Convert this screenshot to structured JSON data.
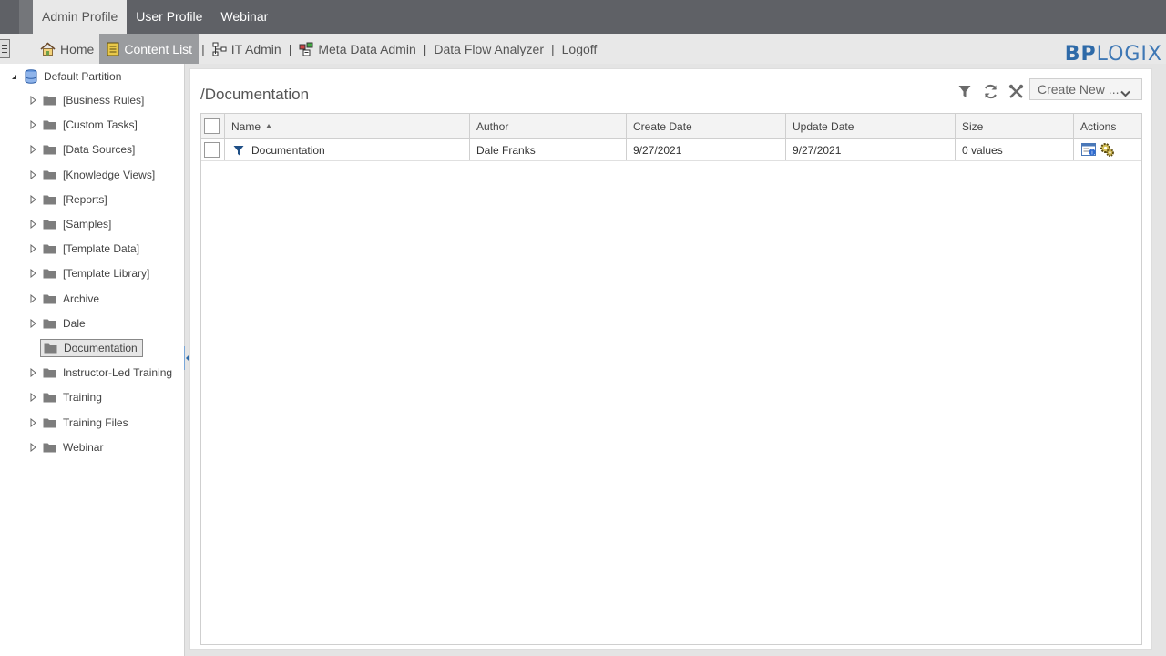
{
  "profile_tabs": [
    "Admin Profile",
    "User Profile",
    "Webinar"
  ],
  "nav": {
    "home": "Home",
    "content_list": "Content List",
    "it_admin": "IT Admin",
    "meta_data_admin": "Meta Data Admin",
    "data_flow_analyzer": "Data Flow Analyzer",
    "logoff": "Logoff",
    "separator": "|"
  },
  "logo": {
    "part1": "BP",
    "part2": "LOGIX"
  },
  "tree": {
    "root": "Default Partition",
    "items": [
      {
        "label": "[Business Rules]",
        "expandable": true
      },
      {
        "label": "[Custom Tasks]",
        "expandable": true
      },
      {
        "label": "[Data Sources]",
        "expandable": true
      },
      {
        "label": "[Knowledge Views]",
        "expandable": true
      },
      {
        "label": "[Reports]",
        "expandable": true
      },
      {
        "label": "[Samples]",
        "expandable": true
      },
      {
        "label": "[Template Data]",
        "expandable": true
      },
      {
        "label": "[Template Library]",
        "expandable": true
      },
      {
        "label": "Archive",
        "expandable": true
      },
      {
        "label": "Dale",
        "expandable": true
      },
      {
        "label": "Documentation",
        "expandable": false,
        "selected": true
      },
      {
        "label": "Instructor-Led Training",
        "expandable": true
      },
      {
        "label": "Training",
        "expandable": true
      },
      {
        "label": "Training Files",
        "expandable": true
      },
      {
        "label": "Webinar",
        "expandable": true
      }
    ]
  },
  "content": {
    "folder_path": "/Documentation",
    "create_new_label": "Create New ...",
    "columns": {
      "name": "Name",
      "author": "Author",
      "create_date": "Create Date",
      "update_date": "Update Date",
      "size": "Size",
      "actions": "Actions"
    },
    "rows": [
      {
        "name": "Documentation",
        "author": "Dale Franks",
        "create_date": "9/27/2021",
        "update_date": "9/27/2021",
        "size": "0 values"
      }
    ]
  },
  "colors": {
    "topbar": "#5f6166",
    "navbar": "#e8e8e8",
    "nav_active": "#9a9c9f",
    "brand_blue": "#2e6aa8",
    "folder_gray": "#7d7d7d"
  }
}
